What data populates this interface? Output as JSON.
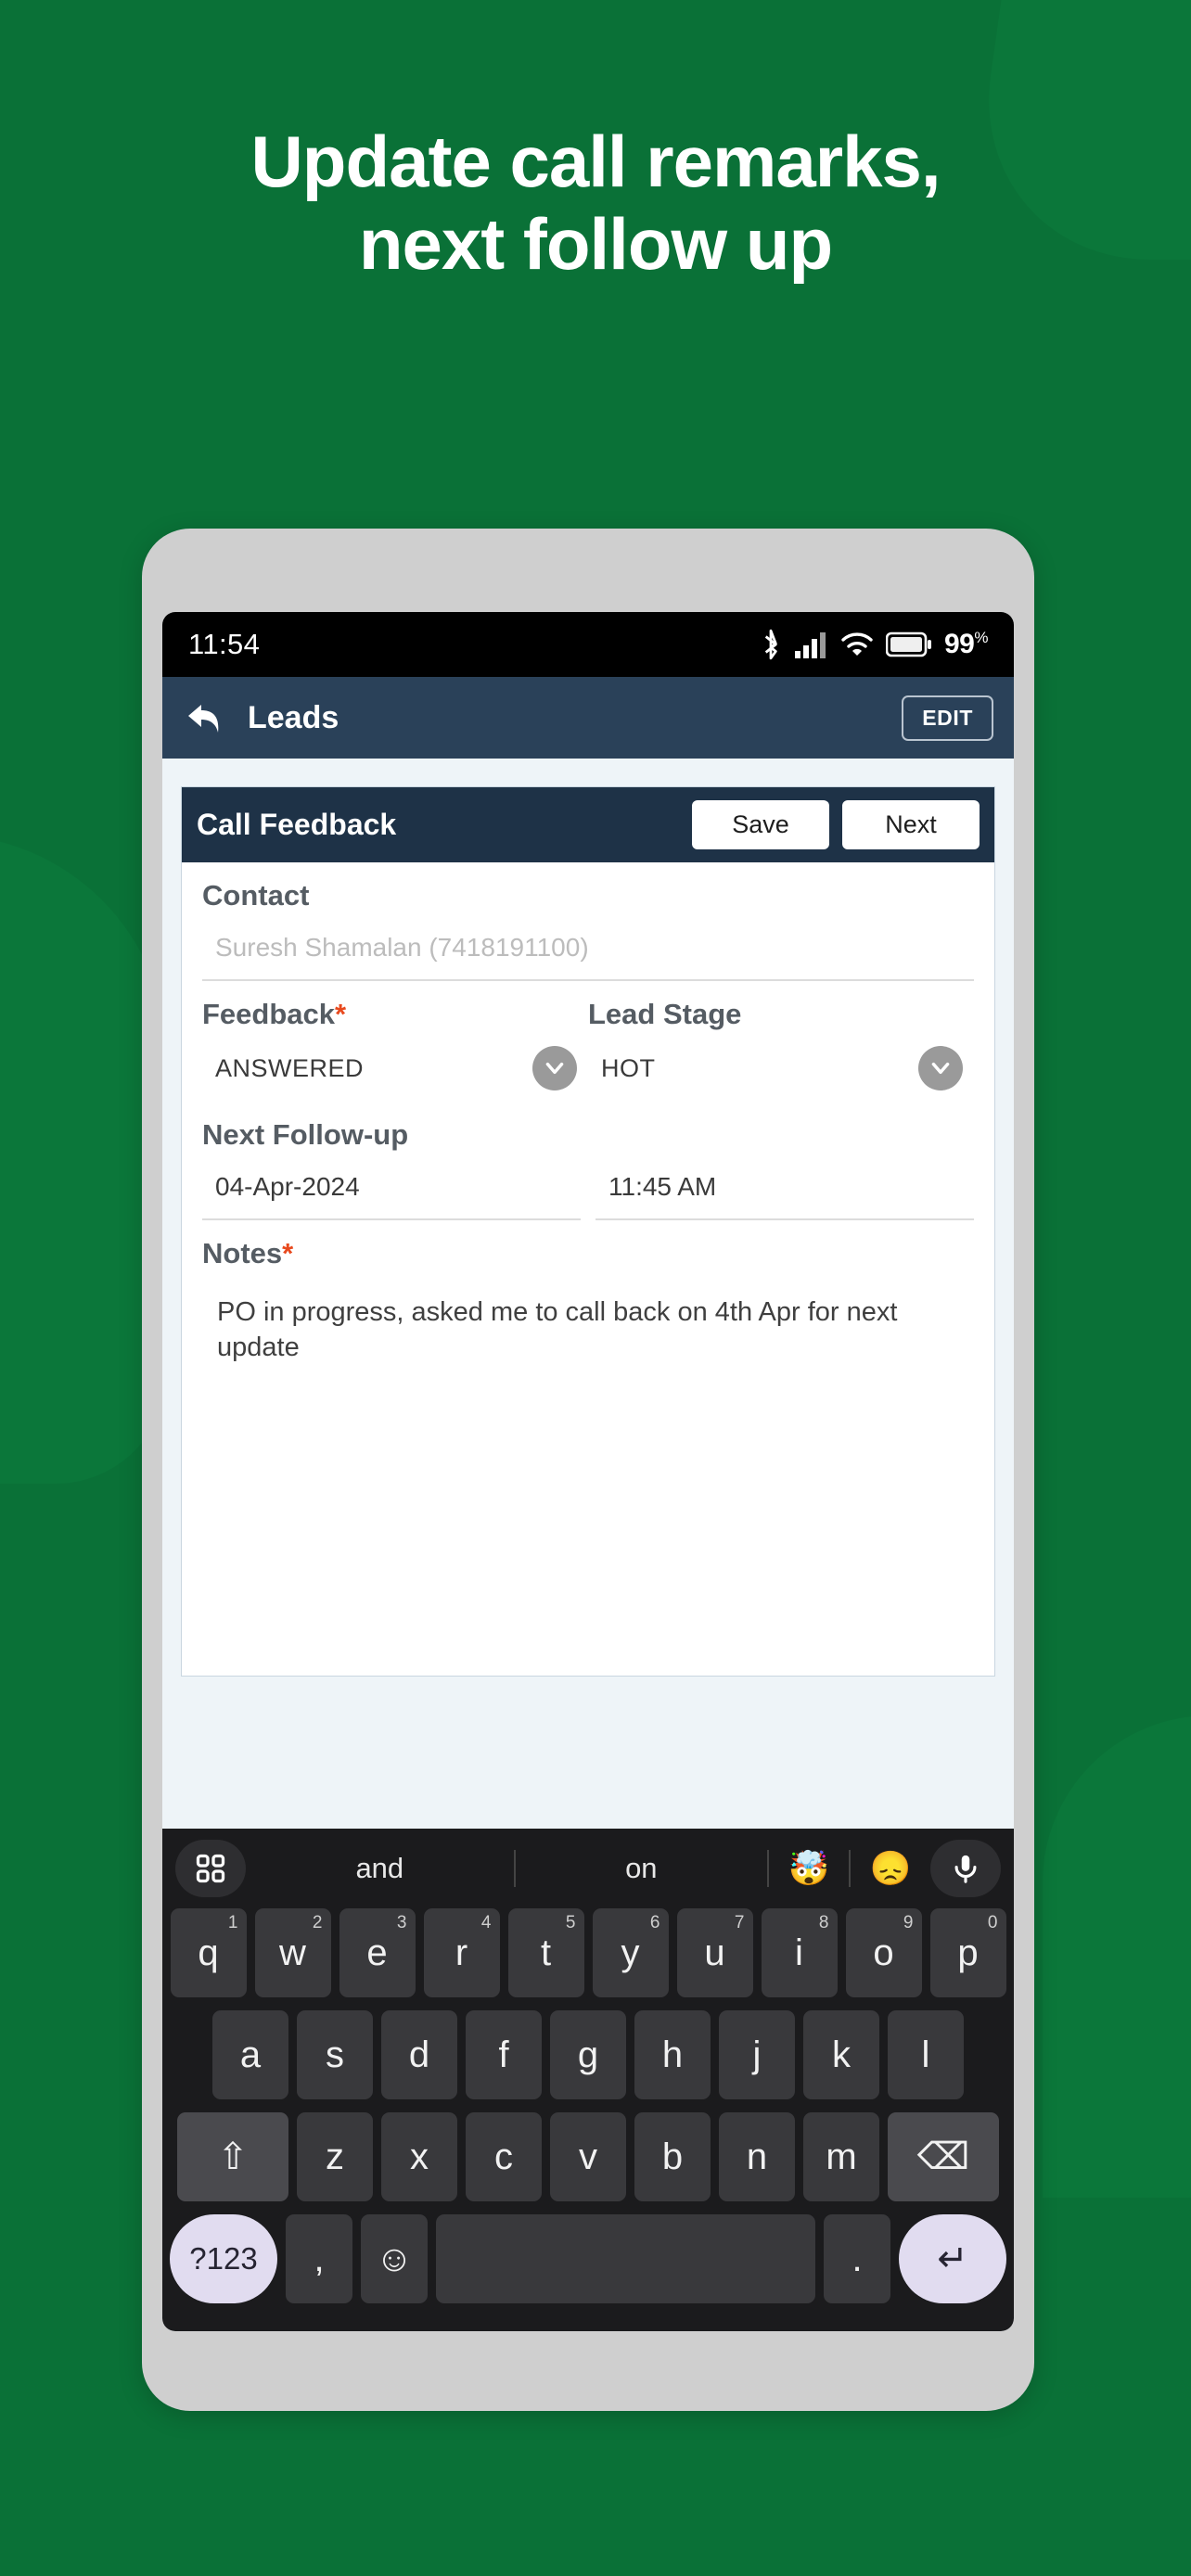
{
  "brand": {
    "bg_green": "#0a7137",
    "appbar": "#2a4159",
    "card_header": "#1e3247",
    "required_red": "#e8491d",
    "accent_key": "#e1dcf0"
  },
  "headline": {
    "line1": "Update call remarks,",
    "line2": "next follow up"
  },
  "status_bar": {
    "time": "11:54",
    "battery_percent": "99",
    "battery_unit": "%",
    "icons": [
      "bluetooth-icon",
      "cellular-signal-icon",
      "wifi-icon",
      "battery-icon"
    ]
  },
  "app_bar": {
    "back_icon": "back-arrow-icon",
    "title": "Leads",
    "edit_label": "EDIT"
  },
  "card": {
    "title": "Call Feedback",
    "save_label": "Save",
    "next_label": "Next",
    "contact": {
      "label": "Contact",
      "value": "Suresh Shamalan (7418191100)"
    },
    "feedback": {
      "label": "Feedback",
      "required": "*",
      "value": "ANSWERED"
    },
    "lead_stage": {
      "label": "Lead Stage",
      "required": "",
      "value": "HOT"
    },
    "next_followup": {
      "label": "Next Follow-up",
      "date": "04-Apr-2024",
      "time": "11:45 AM"
    },
    "notes": {
      "label": "Notes",
      "required": "*",
      "value": "PO in progress, asked me to call back on 4th Apr for next update"
    }
  },
  "keyboard": {
    "suggestions": {
      "grid_icon": "keyboard-grid-icon",
      "word1": "and",
      "word2": "on",
      "emoji1": "🤯",
      "emoji2": "😞",
      "mic_icon": "microphone-icon"
    },
    "row1": [
      {
        "k": "q",
        "h": "1"
      },
      {
        "k": "w",
        "h": "2"
      },
      {
        "k": "e",
        "h": "3"
      },
      {
        "k": "r",
        "h": "4"
      },
      {
        "k": "t",
        "h": "5"
      },
      {
        "k": "y",
        "h": "6"
      },
      {
        "k": "u",
        "h": "7"
      },
      {
        "k": "i",
        "h": "8"
      },
      {
        "k": "o",
        "h": "9"
      },
      {
        "k": "p",
        "h": "0"
      }
    ],
    "row2": [
      "a",
      "s",
      "d",
      "f",
      "g",
      "h",
      "j",
      "k",
      "l"
    ],
    "row3": {
      "shift": "⇧",
      "keys": [
        "z",
        "x",
        "c",
        "v",
        "b",
        "n",
        "m"
      ],
      "backspace": "⌫"
    },
    "row4": {
      "numbers": "?123",
      "comma": ",",
      "emoji": "☺",
      "space": "",
      "period": ".",
      "enter": "↵"
    }
  }
}
